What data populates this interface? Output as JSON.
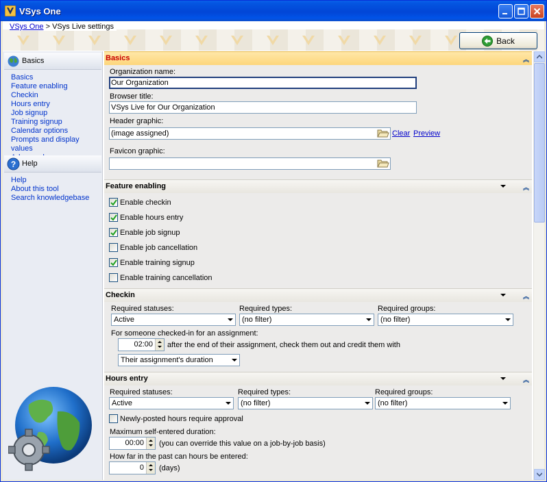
{
  "window": {
    "title": "VSys One"
  },
  "breadcrumb": {
    "root": "VSys One",
    "separator": ">",
    "current": "VSys Live settings"
  },
  "toolbar": {
    "back_label": "Back"
  },
  "sidebar": {
    "basics_header": "Basics",
    "basics_links": [
      "Basics",
      "Feature enabling",
      "Checkin",
      "Hours entry",
      "Job signup",
      "Training signup",
      "Calendar options",
      "Prompts and display values",
      "Advanced"
    ],
    "help_header": "Help",
    "help_links": [
      "Help",
      "About this tool",
      "Search knowledgebase"
    ]
  },
  "basics": {
    "title": "Basics",
    "org_label": "Organization name:",
    "org_value": "Our Organization",
    "browser_label": "Browser title:",
    "browser_value": "VSys Live for Our Organization",
    "header_label": "Header graphic:",
    "header_value": "(image assigned)",
    "clear_label": "Clear",
    "preview_label": "Preview",
    "favicon_label": "Favicon graphic:",
    "favicon_value": ""
  },
  "features": {
    "title": "Feature enabling",
    "items": [
      {
        "label": "Enable checkin",
        "checked": true
      },
      {
        "label": "Enable hours entry",
        "checked": true
      },
      {
        "label": "Enable job signup",
        "checked": true
      },
      {
        "label": "Enable job cancellation",
        "checked": false
      },
      {
        "label": "Enable training signup",
        "checked": true
      },
      {
        "label": "Enable training cancellation",
        "checked": false
      }
    ]
  },
  "checkin": {
    "title": "Checkin",
    "statuses_label": "Required statuses:",
    "statuses_value": "Active",
    "types_label": "Required types:",
    "types_value": "(no filter)",
    "groups_label": "Required groups:",
    "groups_value": "(no filter)",
    "for_label": "For someone checked-in for an assignment:",
    "time_value": "02:00",
    "after_text": "after the end of their assignment, check them out and credit them with",
    "credit_value": "Their assignment's duration"
  },
  "hours": {
    "title": "Hours entry",
    "statuses_label": "Required statuses:",
    "statuses_value": "Active",
    "types_label": "Required types:",
    "types_value": "(no filter)",
    "groups_label": "Required groups:",
    "groups_value": "(no filter)",
    "approval_label": "Newly-posted hours require approval",
    "approval_checked": false,
    "max_label": "Maximum self-entered duration:",
    "max_value": "00:00",
    "max_note": "(you can override this value on a job-by-job basis)",
    "past_label": "How far in the past can hours be entered:",
    "past_value": "0",
    "past_unit": "(days)"
  },
  "colors": {
    "title_bar": "#0246d6",
    "active_section": "#fdd67b",
    "active_section_text": "#c80000",
    "link": "#0033cc"
  }
}
